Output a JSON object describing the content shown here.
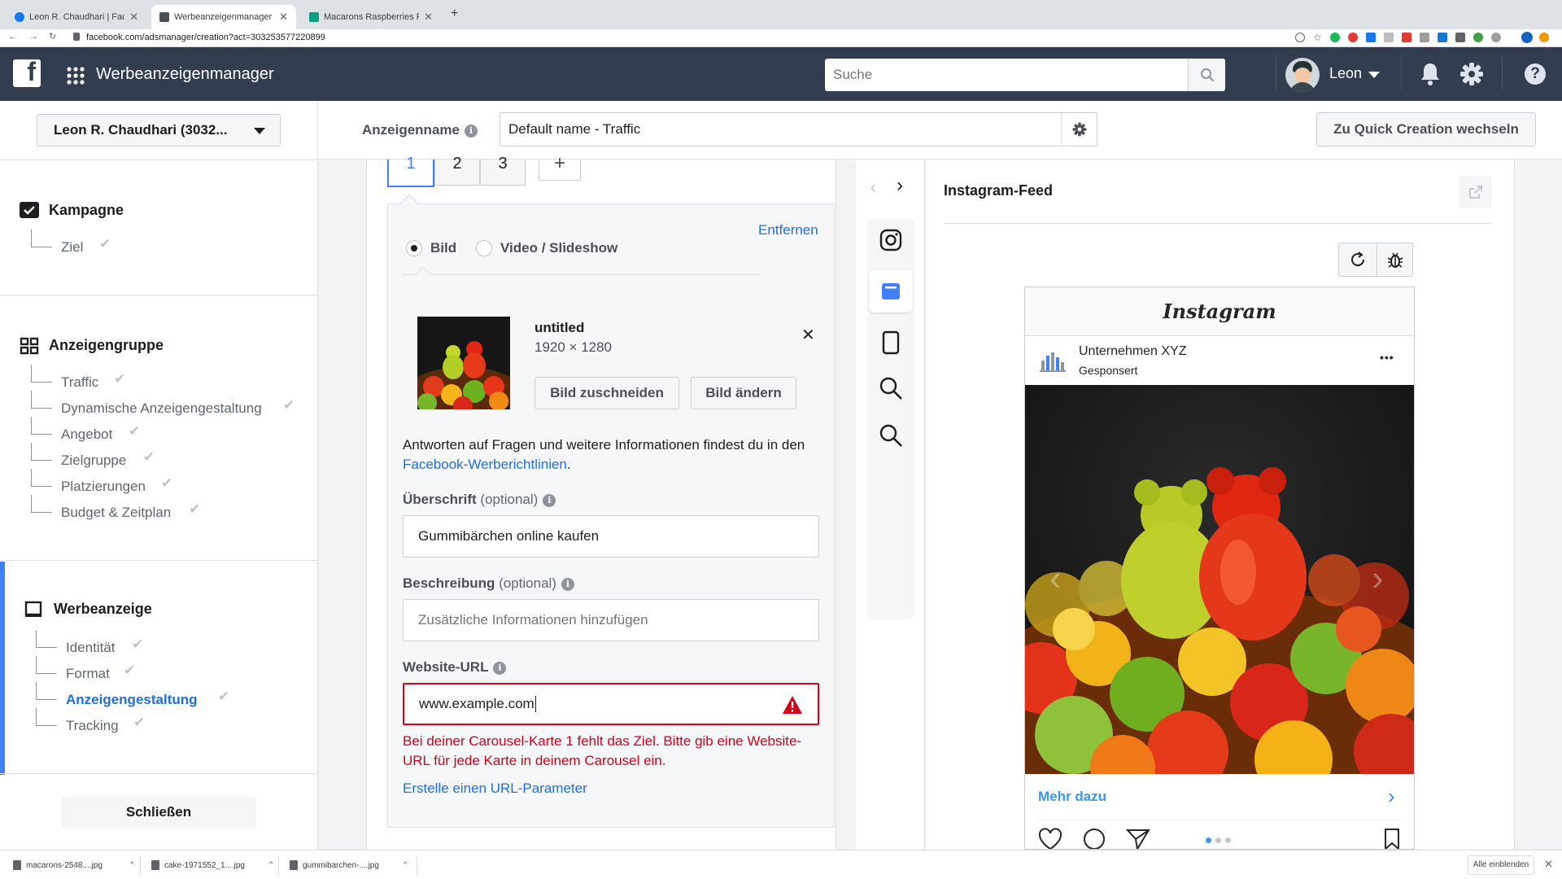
{
  "browser": {
    "tabs": [
      {
        "title": "Leon R. Chaudhari | Facebook",
        "color": "#1877f2"
      },
      {
        "title": "Werbeanzeigenmanager - Crea",
        "color": "#4b4f56"
      },
      {
        "title": "Macarons Raspberries Pastries",
        "color": "#05a081"
      }
    ],
    "url": "facebook.com/adsmanager/creation?act=303253577220899",
    "new_tab": "+"
  },
  "topbar": {
    "logo": "f",
    "app_title": "Werbeanzeigenmanager",
    "search_placeholder": "Suche",
    "user_name": "Leon"
  },
  "account": {
    "selector_label": "Leon R. Chaudhari (3032..."
  },
  "ad_name": {
    "label": "Anzeigenname",
    "value": "Default name - Traffic"
  },
  "quick_creation_label": "Zu Quick Creation wechseln",
  "nav": {
    "campaign": {
      "title": "Kampagne",
      "items": [
        "Ziel"
      ]
    },
    "adset": {
      "title": "Anzeigengruppe",
      "items": [
        "Traffic",
        "Dynamische Anzeigengestaltung",
        "Angebot",
        "Zielgruppe",
        "Platzierungen",
        "Budget & Zeitplan"
      ]
    },
    "ad": {
      "title": "Werbeanzeige",
      "items": [
        "Identität",
        "Format",
        "Anzeigengestaltung",
        "Tracking"
      ],
      "active": "Anzeigengestaltung"
    },
    "close_label": "Schließen"
  },
  "cards": {
    "tabs": [
      "1",
      "2",
      "3"
    ],
    "add": "+"
  },
  "editor": {
    "remove_label": "Entfernen",
    "media_options": [
      "Bild",
      "Video / Slideshow"
    ],
    "image": {
      "name": "untitled",
      "size": "1920 × 1280",
      "crop_label": "Bild zuschneiden",
      "change_label": "Bild ändern"
    },
    "policy_text": "Antworten auf Fragen und weitere Informationen findest du in den",
    "policy_link": "Facebook-Werberichtlinien",
    "policy_end": ".",
    "headline": {
      "label": "Überschrift",
      "optional": "(optional)",
      "value": "Gummibärchen online kaufen"
    },
    "description": {
      "label": "Beschreibung",
      "optional": "(optional)",
      "placeholder": "Zusätzliche Informationen hinzufügen"
    },
    "url": {
      "label": "Website-URL",
      "value": "www.example.com",
      "error": "Bei deiner Carousel-Karte 1 fehlt das Ziel. Bitte gib eine Website-URL für jede Karte in deinem Carousel ein."
    },
    "url_param_link": "Erstelle einen URL-Parameter"
  },
  "preview": {
    "title": "Instagram-Feed",
    "ig_logo": "Instagram",
    "account_name": "Unternehmen XYZ",
    "sponsored": "Gesponsert",
    "more": "•••",
    "cta": "Mehr dazu"
  },
  "downloads": {
    "files": [
      "macarons-2548....jpg",
      "cake-1971552_1....jpg",
      "gummibarchen-....jpg"
    ],
    "show_all": "Alle einblenden"
  },
  "colors": {
    "fb_bar": "#323e50",
    "link": "#216fdb",
    "error": "#d0021b",
    "accent": "#4080ff"
  }
}
